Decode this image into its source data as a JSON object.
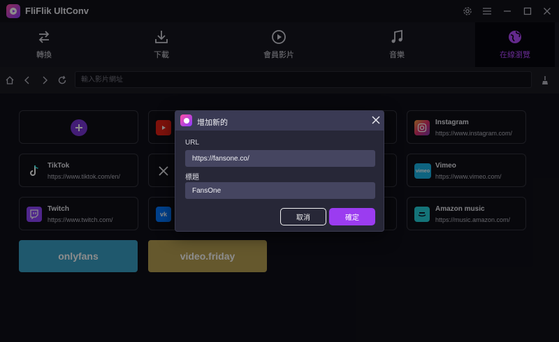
{
  "app": {
    "title": "FliFlik UltConv"
  },
  "nav_tabs": [
    {
      "label": "轉換",
      "icon": "convert-arrows-icon"
    },
    {
      "label": "下載",
      "icon": "download-icon"
    },
    {
      "label": "會員影片",
      "icon": "play-circle-icon"
    },
    {
      "label": "音樂",
      "icon": "music-note-icon"
    },
    {
      "label": "在線瀏覽",
      "icon": "globe-icon",
      "active": true
    }
  ],
  "address_bar": {
    "placeholder": "輸入影片網址",
    "value": ""
  },
  "sites": [
    {
      "name": "",
      "url": "",
      "icon": "add-icon"
    },
    {
      "name": "",
      "url": "",
      "icon": "youtube-icon"
    },
    {
      "name": "",
      "url": "",
      "icon": "hidden"
    },
    {
      "name": "Instagram",
      "url": "https://www.instagram.com/",
      "icon": "instagram-icon"
    },
    {
      "name": "TikTok",
      "url": "https://www.tiktok.com/en/",
      "icon": "tiktok-icon"
    },
    {
      "name": "",
      "url": "",
      "icon": "x-icon"
    },
    {
      "name": "",
      "url": "",
      "icon": "hidden"
    },
    {
      "name": "Vimeo",
      "url": "https://www.vimeo.com/",
      "icon": "vimeo-icon"
    },
    {
      "name": "Twitch",
      "url": "https://www.twitch.com/",
      "icon": "twitch-icon"
    },
    {
      "name": "",
      "url": "",
      "icon": "vk-icon"
    },
    {
      "name": "",
      "url": "",
      "icon": "hidden"
    },
    {
      "name": "Amazon music",
      "url": "https://music.amazon.com/",
      "icon": "amazon-music-icon"
    }
  ],
  "custom_sites": [
    {
      "label": "onlyfans",
      "color": "#3aa0c6"
    },
    {
      "label": "video.friday",
      "color": "#b8a052"
    }
  ],
  "dialog": {
    "title": "增加新的",
    "url_label": "URL",
    "url_value": "https://fansone.co/",
    "title_label": "標題",
    "title_value": "FansOne",
    "cancel_label": "取消",
    "ok_label": "確定"
  },
  "colors": {
    "accent": "#9b3cf0",
    "active_tab_text": "#b44cff"
  }
}
